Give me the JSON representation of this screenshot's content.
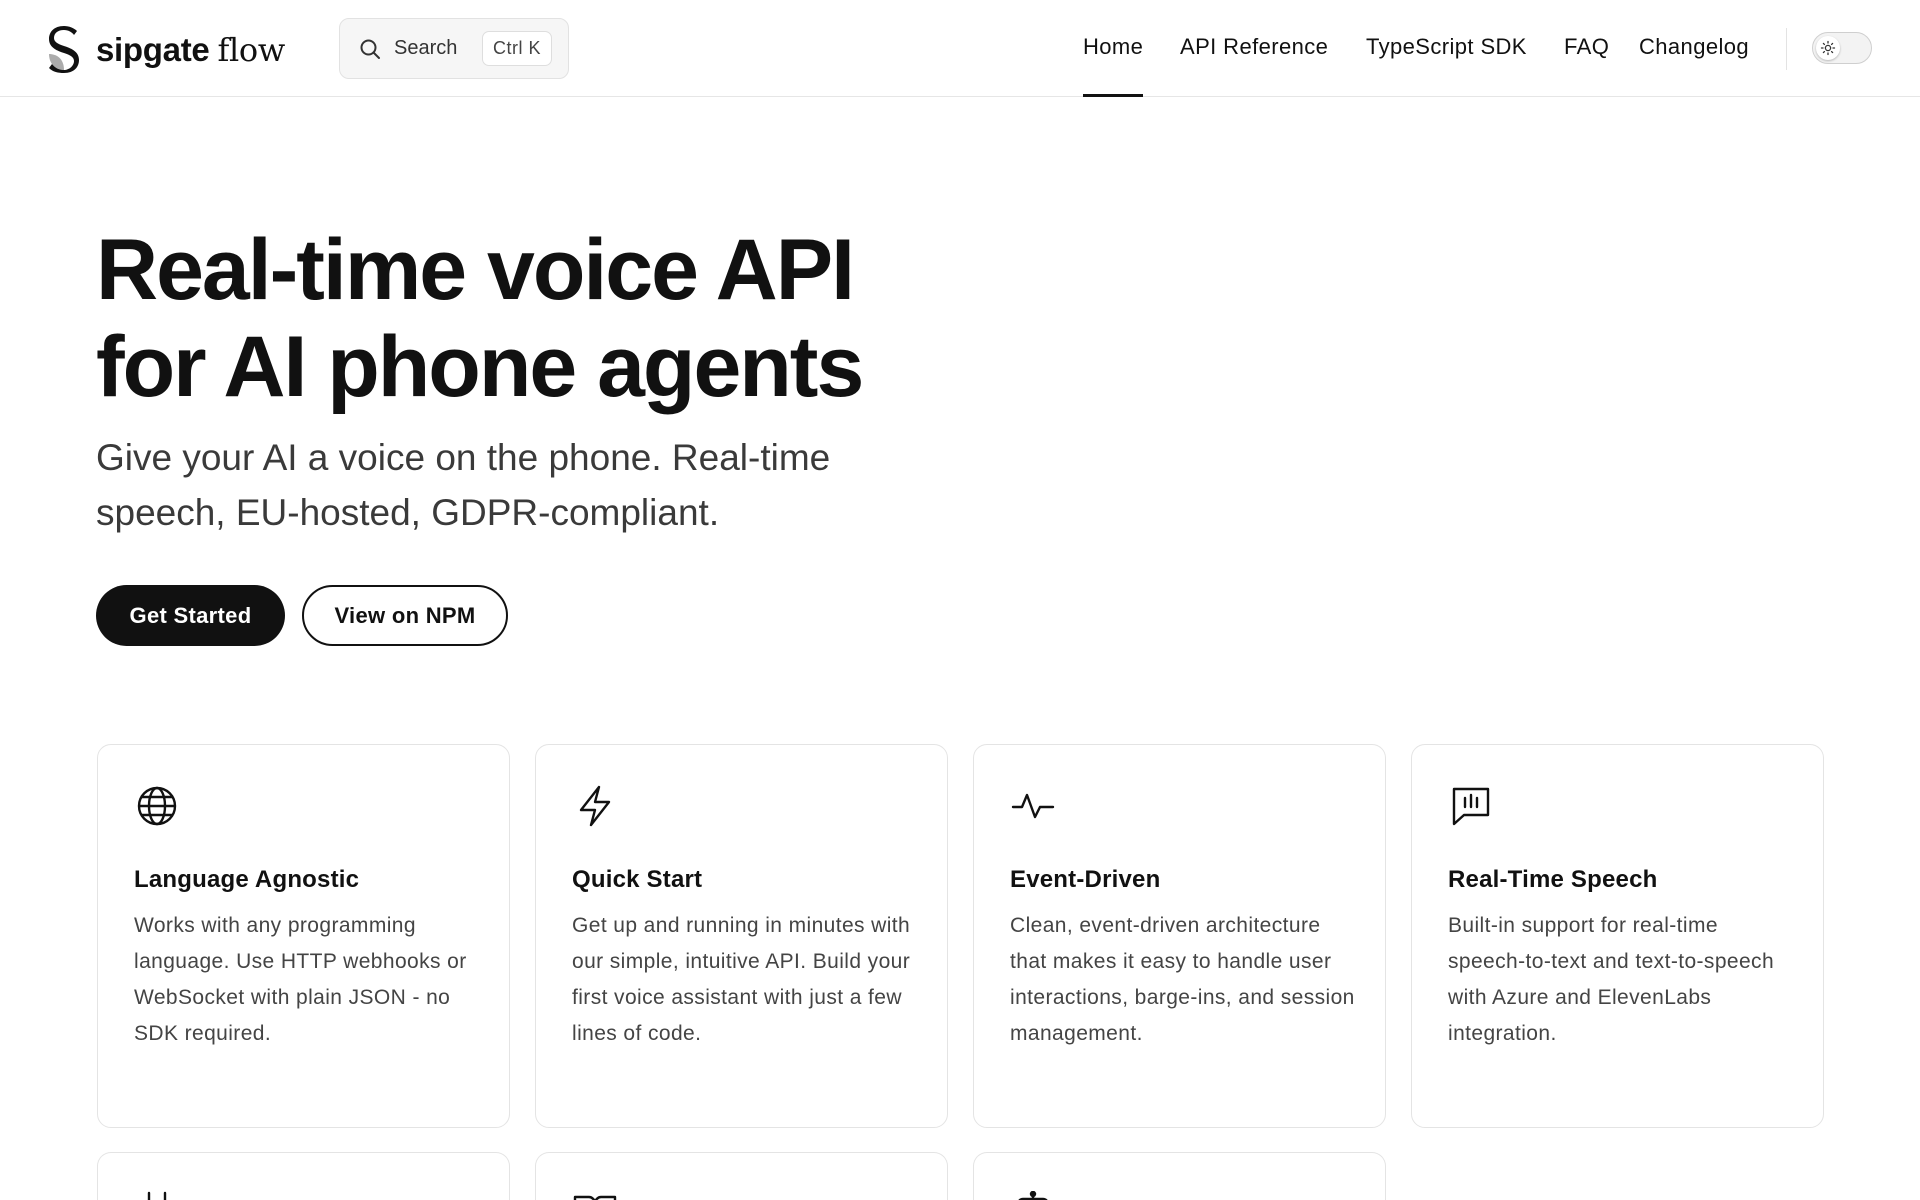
{
  "header": {
    "logo": {
      "brand": "sipgate",
      "product": "flow"
    },
    "search": {
      "label": "Search",
      "shortcut": "Ctrl K"
    },
    "nav": [
      {
        "label": "Home",
        "active": true
      },
      {
        "label": "API Reference",
        "active": false
      },
      {
        "label": "TypeScript SDK",
        "active": false
      },
      {
        "label": "FAQ",
        "active": false
      },
      {
        "label": "Changelog",
        "active": false
      }
    ],
    "theme_toggle": {
      "icon": "sun-icon",
      "mode": "light"
    }
  },
  "hero": {
    "title_line1": "Real-time voice API",
    "title_line2": "for AI phone agents",
    "subtitle": "Give your AI a voice on the phone. Real-time speech, EU-hosted, GDPR-compliant.",
    "primary_button": "Get Started",
    "secondary_button": "View on NPM"
  },
  "features": [
    {
      "icon": "globe-icon",
      "title": "Language Agnostic",
      "description": "Works with any programming language. Use HTTP webhooks or WebSocket with plain JSON - no SDK required."
    },
    {
      "icon": "lightning-icon",
      "title": "Quick Start",
      "description": "Get up and running in minutes with our simple, intuitive API. Build your first voice assistant with just a few lines of code."
    },
    {
      "icon": "activity-icon",
      "title": "Event-Driven",
      "description": "Clean, event-driven architecture that makes it easy to handle user interactions, barge-ins, and session management."
    },
    {
      "icon": "speech-bubble-icon",
      "title": "Real-Time Speech",
      "description": "Built-in support for real-time speech-to-text and text-to-speech with Azure and ElevenLabs integration."
    }
  ],
  "partial_features": [
    {
      "icon": "plug-icon"
    },
    {
      "icon": "book-icon"
    },
    {
      "icon": "bot-icon"
    }
  ],
  "colors": {
    "text": "#111111",
    "muted": "#444444",
    "border": "#e4e4e4",
    "primary_button_bg": "#111111"
  }
}
